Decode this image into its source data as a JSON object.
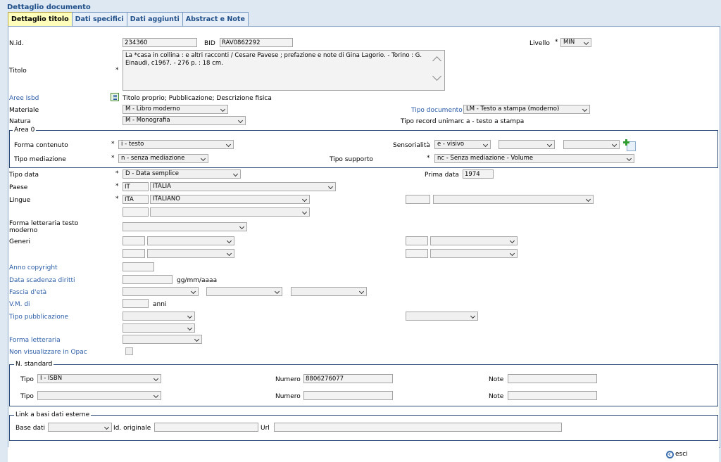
{
  "page_title": "Dettaglio documento",
  "tabs": [
    "Dettaglio titolo",
    "Dati specifici",
    "Dati aggiunti",
    "Abstract e Note"
  ],
  "asterisk": "*",
  "nid": {
    "label": "N.id.",
    "value": "234360"
  },
  "bid": {
    "label": "BID",
    "value": "RAV0862292"
  },
  "livello": {
    "label": "Livello",
    "value": "MIN"
  },
  "titolo": {
    "label": "Titolo",
    "value": "La *casa in collina : e altri racconti / Cesare Pavese ; prefazione e note di Gina Lagorio. - Torino : G. Einaudi, c1967. - 276 p. : 18 cm."
  },
  "aree_isbd": {
    "label": "Aree Isbd",
    "value": "Titolo proprio; Pubblicazione; Descrizione fisica"
  },
  "materiale": {
    "label": "Materiale",
    "value": "M - Libro moderno"
  },
  "tipo_documento": {
    "label": "Tipo documento",
    "value": "LM - Testo a stampa (moderno)"
  },
  "natura": {
    "label": "Natura",
    "value": "M - Monografia"
  },
  "tipo_record": {
    "label": "Tipo record unimarc",
    "value": "a - testo a stampa"
  },
  "area0": {
    "legend": "Area 0",
    "forma_contenuto": {
      "label": "Forma contenuto",
      "value": "i - testo"
    },
    "sensorialita": {
      "label": "Sensorialità",
      "value": "e - visivo"
    },
    "tipo_mediazione": {
      "label": "Tipo mediazione",
      "value": "n - senza mediazione"
    },
    "tipo_supporto": {
      "label": "Tipo supporto",
      "value": "nc - Senza mediazione - Volume"
    }
  },
  "tipo_data": {
    "label": "Tipo data",
    "value": "D - Data semplice"
  },
  "prima_data": {
    "label": "Prima data",
    "value": "1974"
  },
  "paese": {
    "label": "Paese",
    "code": "IT",
    "name": "ITALIA"
  },
  "lingue": {
    "label": "Lingue",
    "code": "ITA",
    "name": "ITALIANO"
  },
  "forma_letteraria_testo": {
    "label": "Forma letteraria testo moderno"
  },
  "generi": {
    "label": "Generi"
  },
  "anno_copyright": {
    "label": "Anno copyright"
  },
  "data_scadenza": {
    "label": "Data scadenza diritti",
    "hint": "gg/mm/aaaa"
  },
  "fascia_eta": {
    "label": "Fascia d'età"
  },
  "vm": {
    "label": "V.M. di",
    "hint": "anni"
  },
  "tipo_pubblicazione": {
    "label": "Tipo pubblicazione"
  },
  "forma_letteraria": {
    "label": "Forma letteraria"
  },
  "non_visualizzare": {
    "label": "Non visualizzare in Opac"
  },
  "nstandard": {
    "legend": "N. standard",
    "tipo_label": "Tipo",
    "numero_label": "Numero",
    "note_label": "Note",
    "row1": {
      "tipo": "I - ISBN",
      "numero": "8806276077",
      "note": ""
    },
    "row2": {
      "tipo": "",
      "numero": "",
      "note": ""
    }
  },
  "link": {
    "legend": "Link a basi dati esterne",
    "base_dati_label": "Base dati",
    "id_originale_label": "Id. originale",
    "url_label": "Url"
  },
  "footer": {
    "esci_label": "esci"
  },
  "colors": {
    "accent": "#2a5ca8",
    "active_tab": "#ffffbb",
    "background": "#dde8f2"
  }
}
